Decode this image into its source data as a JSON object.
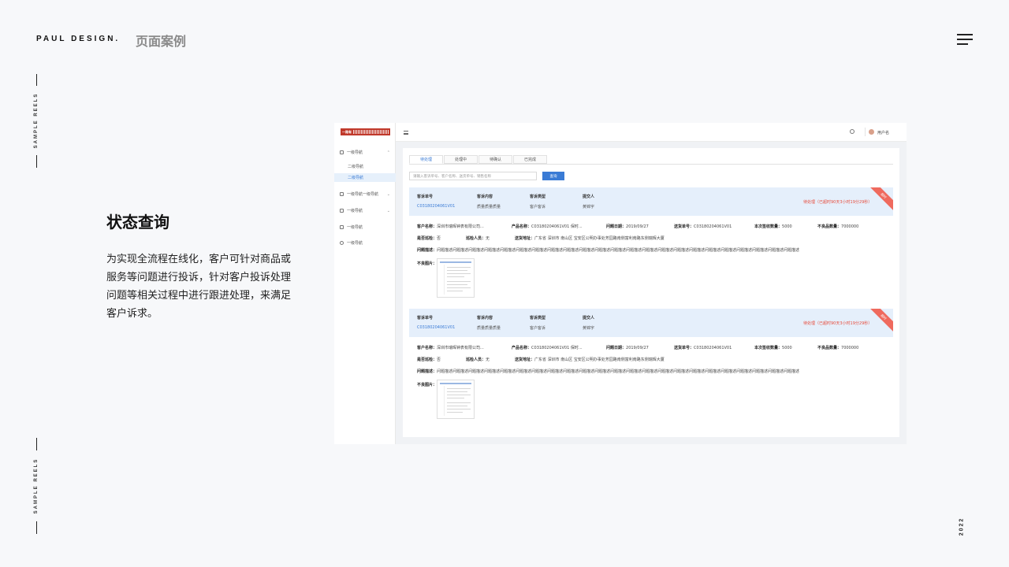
{
  "header": {
    "brand": "PAUL DESIGN.",
    "page_title": "页面案例",
    "year": "2022",
    "side_text": "SAMPLE REELS"
  },
  "section": {
    "heading": "状态查询",
    "description": "为实现全流程在线化，客户可针对商品或服务等问题进行投诉，针对客户投诉处理问题等相关过程中进行跟进处理，来满足客户诉求。"
  },
  "app": {
    "logo_text": "一路有",
    "sidebar": [
      {
        "label": "一级导航",
        "icon": "home-icon",
        "chevron": "⌃"
      },
      {
        "label": "二级导航",
        "sub": true
      },
      {
        "label": "二级导航",
        "sub": true,
        "active": true
      },
      {
        "label": "一级导航一级导航",
        "icon": "edit-icon",
        "chevron": "⌄"
      },
      {
        "label": "一级导航",
        "icon": "card-icon",
        "chevron": "⌄"
      },
      {
        "label": "一级导航",
        "icon": "doc-icon"
      },
      {
        "label": "一级导航",
        "icon": "gear-icon"
      }
    ],
    "user_name": "用户名",
    "tabs": [
      "待处理",
      "处理中",
      "待确认",
      "已完成"
    ],
    "search_placeholder": "请输入客诉单号、客户名称、送货单号、销售名称",
    "query_button": "查询",
    "card": {
      "labels": [
        "客诉单号",
        "客诉内容",
        "客诉类型",
        "提交人"
      ],
      "values": [
        "C03180204061V01",
        "质量质量质量",
        "客户客诉",
        "黄锦宇"
      ],
      "status": "待处理（已超时90天3小时19分29秒）",
      "ribbon": "超时",
      "details_row1": [
        {
          "k": "客户名称：",
          "v": "深圳市瑞晖钟表有限公司..."
        },
        {
          "k": "产品名称：",
          "v": "C03180204061V01 保时..."
        },
        {
          "k": "问题日期：",
          "v": "2019/09/27"
        },
        {
          "k": "送货单号：",
          "v": "C03180204061V01"
        },
        {
          "k": "本次签收数量：",
          "v": "5000"
        },
        {
          "k": "不良品数量：",
          "v": "7000000"
        }
      ],
      "details_row2": [
        {
          "k": "是否巡检：",
          "v": "否"
        },
        {
          "k": "巡检人员：",
          "v": "无"
        },
        {
          "k": "送货地址：",
          "v": "广东省 深圳市 南山区 宝安区公明办事处芳园路南侧富利南路东侧瑞辉大厦"
        }
      ],
      "problem_label": "问题描述：",
      "problem_text": "问题描述问题描述问题描述问题描述问题描述问题描述问题描述问题描述问题描述问题描述问题描述问题描述问题描述问题描述问题描述问题描述问题描述问题描述问题描述问题描述问题描述问题描述问题描述",
      "image_label": "不良图片："
    }
  }
}
